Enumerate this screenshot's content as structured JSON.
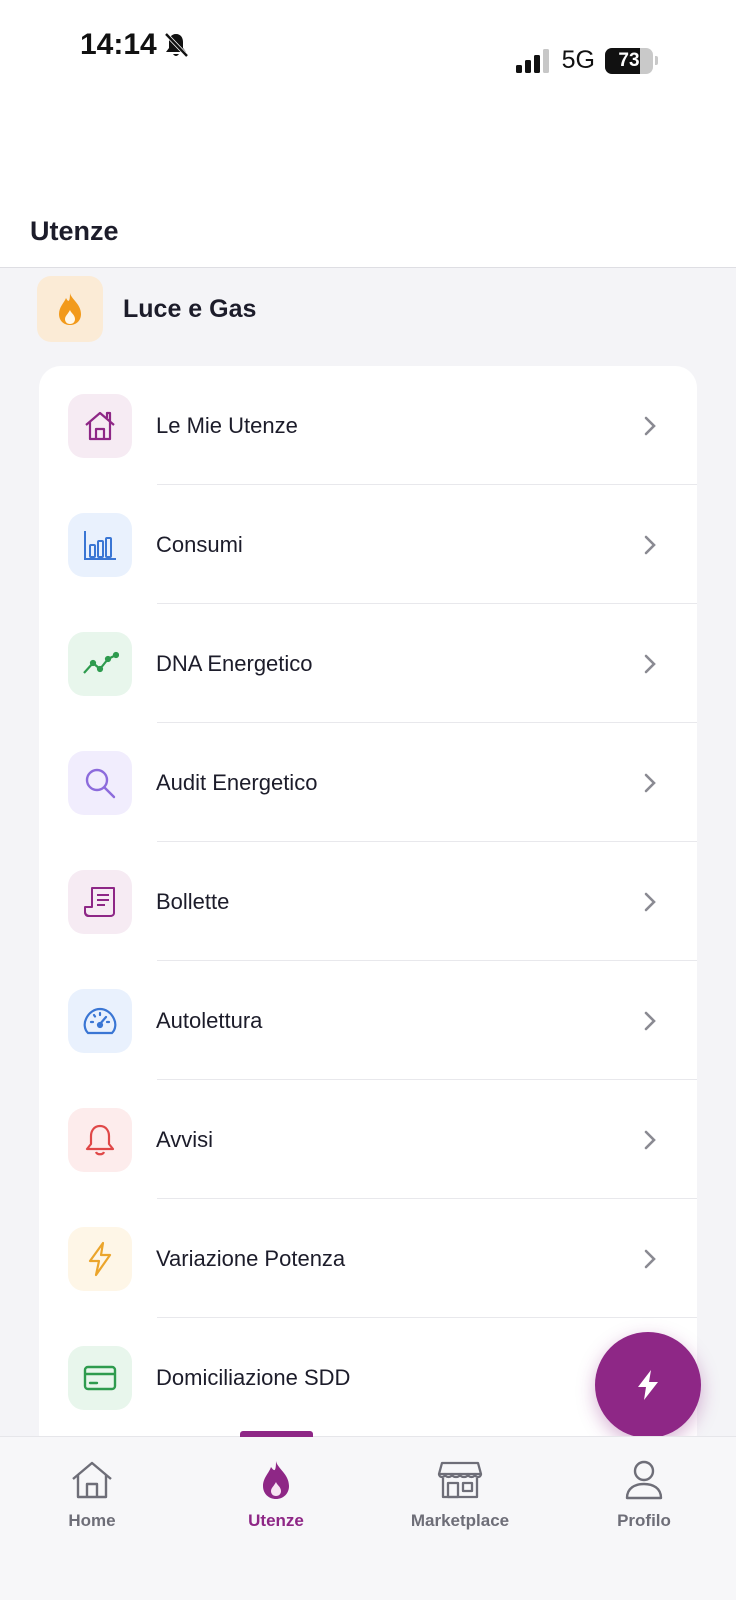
{
  "status_bar": {
    "time": "14:14",
    "network": "5G",
    "battery": "73"
  },
  "header": {
    "title": "Utenze"
  },
  "section": {
    "title": "Luce e Gas",
    "icon": "flame-icon"
  },
  "menu": [
    {
      "label": "Le Mie Utenze",
      "icon": "house-icon",
      "icon_bg": "#f6ebf3",
      "icon_color": "#8e2786"
    },
    {
      "label": "Consumi",
      "icon": "bar-chart-icon",
      "icon_bg": "#e9f1fd",
      "icon_color": "#3a76d4"
    },
    {
      "label": "DNA Energetico",
      "icon": "trend-line-icon",
      "icon_bg": "#e8f6ec",
      "icon_color": "#2e9b4e"
    },
    {
      "label": "Audit Energetico",
      "icon": "magnifier-icon",
      "icon_bg": "#f1edfd",
      "icon_color": "#8c6bdc"
    },
    {
      "label": "Bollette",
      "icon": "receipt-icon",
      "icon_bg": "#f6ebf3",
      "icon_color": "#8e2786"
    },
    {
      "label": "Autolettura",
      "icon": "gauge-icon",
      "icon_bg": "#e9f1fd",
      "icon_color": "#3a76d4"
    },
    {
      "label": "Avvisi",
      "icon": "bell-icon",
      "icon_bg": "#fdecec",
      "icon_color": "#e04848"
    },
    {
      "label": "Variazione Potenza",
      "icon": "lightning-icon",
      "icon_bg": "#fef6e7",
      "icon_color": "#eba52c"
    },
    {
      "label": "Domiciliazione SDD",
      "icon": "credit-card-icon",
      "icon_bg": "#e8f6ec",
      "icon_color": "#2e9b4e"
    }
  ],
  "fab": {
    "icon": "lightning-icon",
    "color": "#8e2786"
  },
  "tabbar": {
    "active": "Utenze",
    "items": [
      {
        "label": "Home",
        "icon": "house-icon"
      },
      {
        "label": "Utenze",
        "icon": "flame-icon"
      },
      {
        "label": "Marketplace",
        "icon": "store-icon"
      },
      {
        "label": "Profilo",
        "icon": "person-icon"
      }
    ]
  },
  "colors": {
    "accent": "#8e2786",
    "orange": "#f29a1b"
  }
}
